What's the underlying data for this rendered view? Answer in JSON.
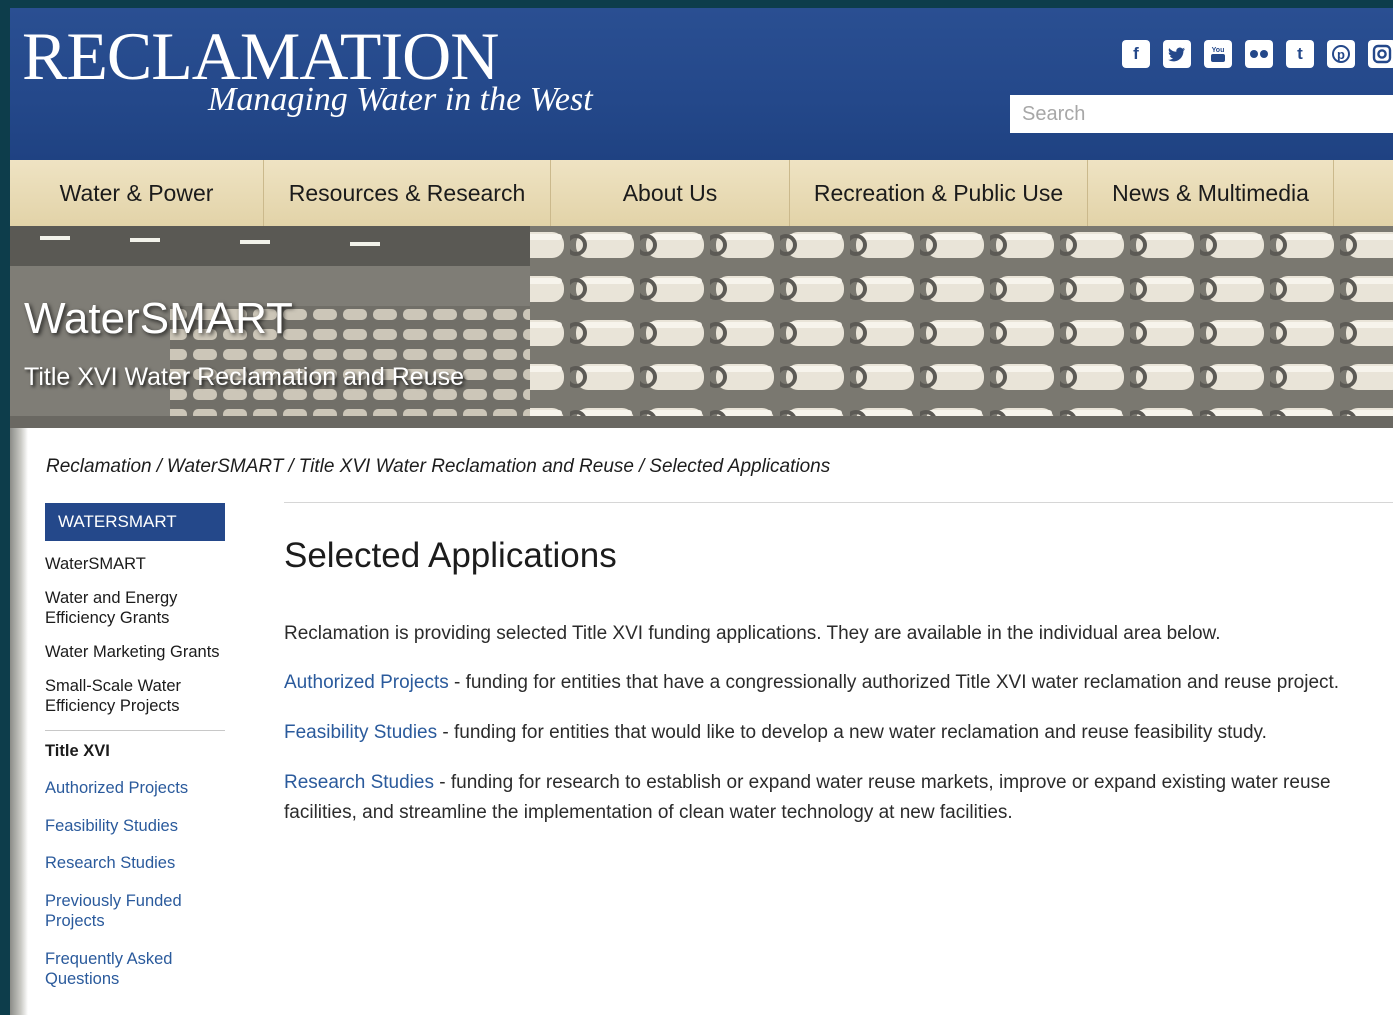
{
  "header": {
    "logo_title": "RECLAMATION",
    "logo_tagline": "Managing Water in the West",
    "search_placeholder": "Search",
    "social_icons": [
      "facebook-icon",
      "twitter-icon",
      "youtube-icon",
      "flickr-icon",
      "tumblr-icon",
      "pinterest-icon",
      "instagram-icon"
    ]
  },
  "nav": {
    "items": [
      "Water & Power",
      "Resources & Research",
      "About Us",
      "Recreation & Public Use",
      "News & Multimedia"
    ]
  },
  "banner": {
    "title": "WaterSMART",
    "subtitle": "Title XVI Water Reclamation and Reuse"
  },
  "breadcrumb": [
    "Reclamation",
    "WaterSMART",
    "Title XVI Water Reclamation and Reuse",
    "Selected Applications"
  ],
  "sidebar": {
    "heading": "WATERSMART",
    "links": [
      "WaterSMART",
      "Water and Energy Efficiency Grants",
      "Water Marketing Grants",
      "Small-Scale Water Efficiency Projects"
    ],
    "section_title": "Title XVI",
    "section_links": [
      "Authorized Projects",
      "Feasibility Studies",
      "Research Studies",
      "Previously Funded Projects",
      "Frequently Asked Questions"
    ]
  },
  "main": {
    "title": "Selected Applications",
    "intro": "Reclamation is providing selected Title XVI funding applications. They are available in the individual area below.",
    "items": [
      {
        "link": "Authorized Projects",
        "text": " - funding for entities that have a congressionally authorized Title XVI water reclamation and reuse project."
      },
      {
        "link": "Feasibility Studies",
        "text": " - funding for entities that would like to develop a new water reclamation and reuse feasibility study."
      },
      {
        "link": "Research Studies",
        "text": " - funding for research to establish or expand water reuse markets, improve or expand existing water reuse facilities, and streamline the implementation of clean water technology at new facilities."
      }
    ]
  },
  "colors": {
    "header_blue": "#24488a",
    "nav_tan": "#e6d8b0",
    "link_blue": "#2a5a9c",
    "page_border": "#0d3d4b"
  }
}
